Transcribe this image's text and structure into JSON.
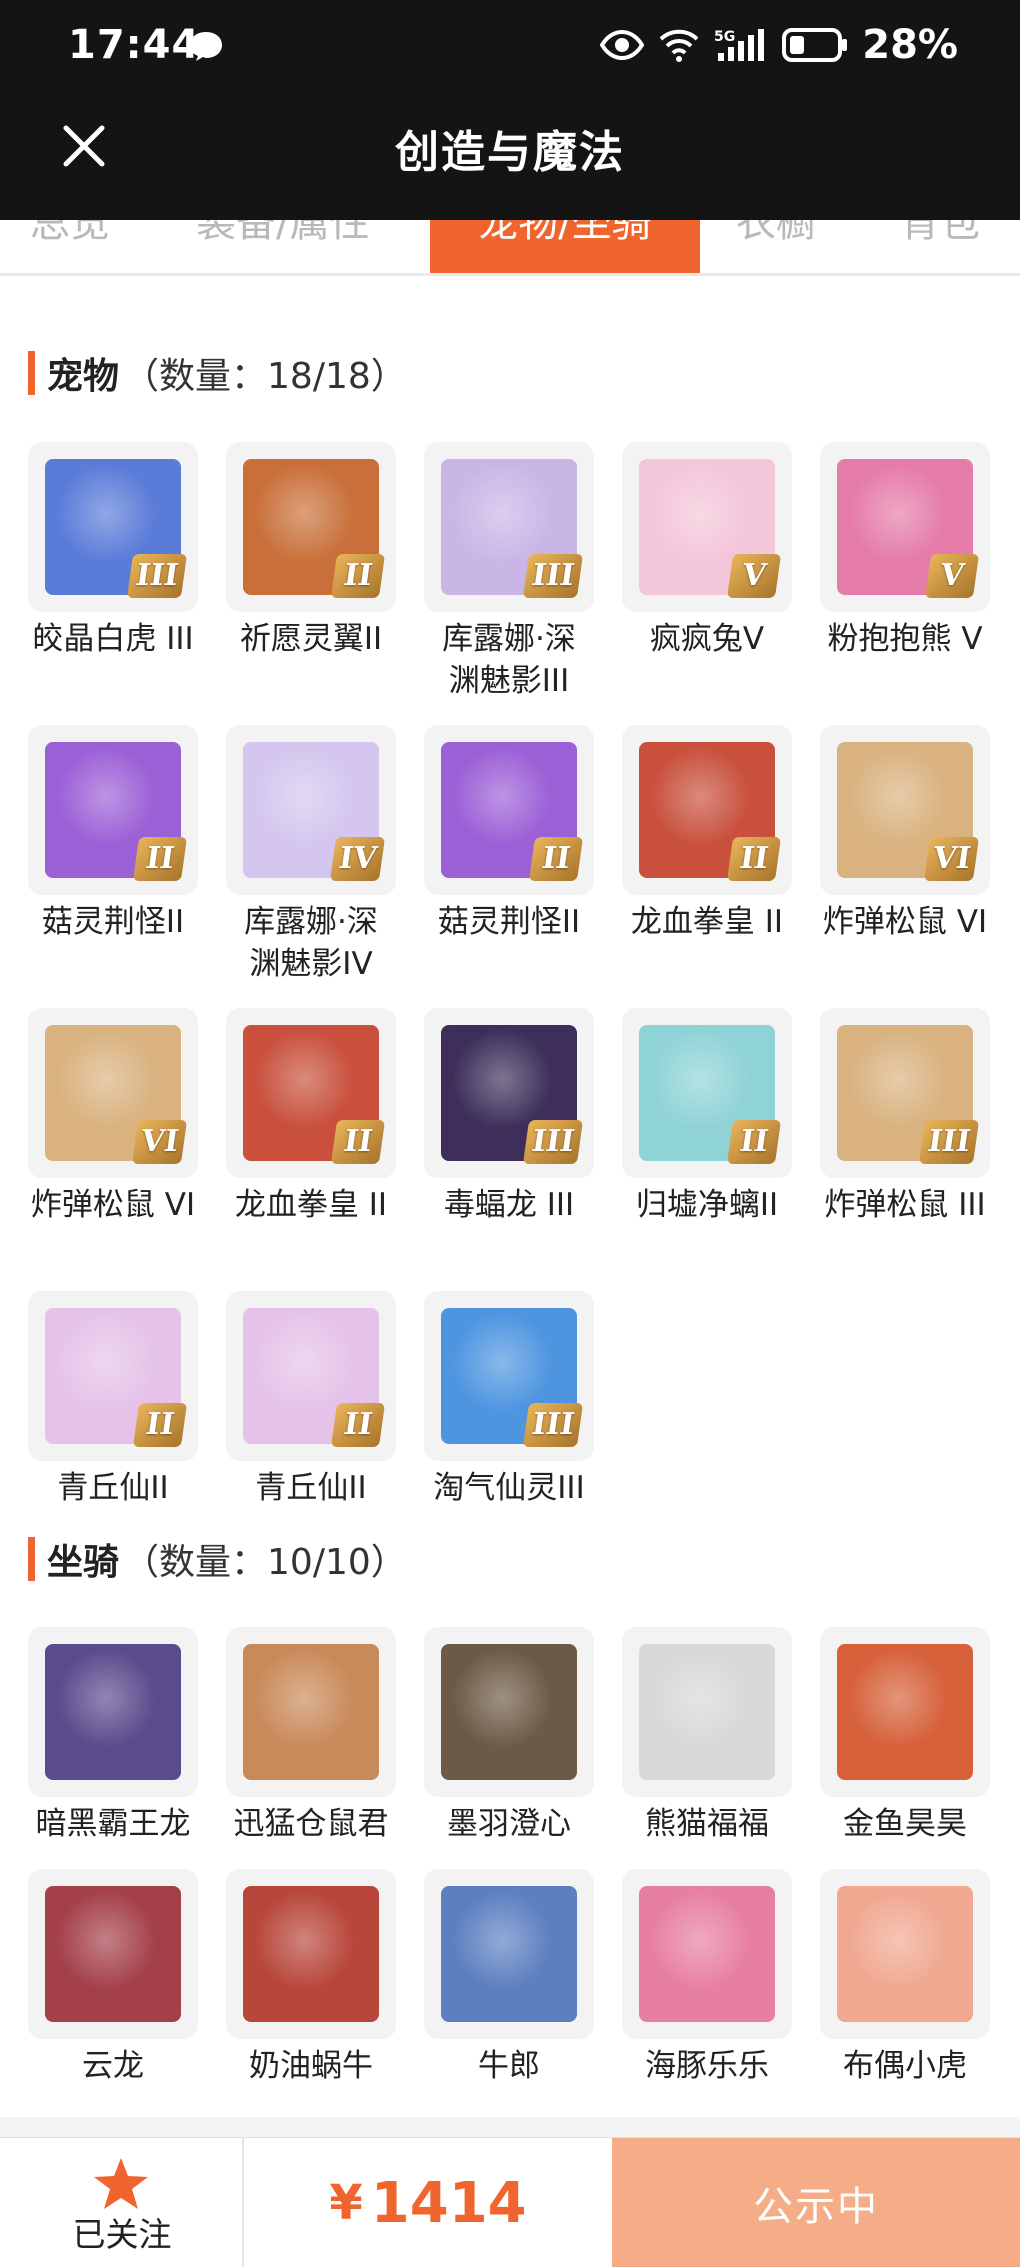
{
  "status_bar": {
    "time": "17:44",
    "battery": "28%",
    "network": "5G"
  },
  "header": {
    "title": "创造与魔法"
  },
  "tabs": [
    {
      "label": "总览"
    },
    {
      "label": "装备/属性"
    },
    {
      "label": "宠物/坐骑",
      "active": true
    },
    {
      "label": "衣橱"
    },
    {
      "label": "背包"
    }
  ],
  "pets": {
    "title": "宠物",
    "count": "（数量：18/18）",
    "items": [
      {
        "label": "皎晶白虎 III",
        "tier": "III",
        "color": "#5a7bd8"
      },
      {
        "label": "祈愿灵翼II",
        "tier": "II",
        "color": "#c9703a"
      },
      {
        "label": "库露娜·深\n渊魅影III",
        "tier": "III",
        "color": "#c9b6e6"
      },
      {
        "label": "疯疯兔V",
        "tier": "V",
        "color": "#f4c6d9"
      },
      {
        "label": "粉抱抱熊 V",
        "tier": "V",
        "color": "#e57ba8"
      },
      {
        "label": "菇灵荆怪II",
        "tier": "II",
        "color": "#9b5fd6"
      },
      {
        "label": "库露娜·深\n渊魅影IV",
        "tier": "IV",
        "color": "#d4c6ee"
      },
      {
        "label": "菇灵荆怪II",
        "tier": "II",
        "color": "#9b5fd6"
      },
      {
        "label": "龙血拳皇 II",
        "tier": "II",
        "color": "#c8503c"
      },
      {
        "label": "炸弹松鼠 VI",
        "tier": "VI",
        "color": "#d9b27f"
      },
      {
        "label": "炸弹松鼠 VI",
        "tier": "VI",
        "color": "#d9b27f"
      },
      {
        "label": "龙血拳皇 II",
        "tier": "II",
        "color": "#c8503c"
      },
      {
        "label": "毒蝠龙 III",
        "tier": "III",
        "color": "#3d2f5a"
      },
      {
        "label": "归墟净螭II",
        "tier": "II",
        "color": "#8fd3d6"
      },
      {
        "label": "炸弹松鼠 III",
        "tier": "III",
        "color": "#d9b27f"
      },
      {
        "label": "青丘仙II",
        "tier": "II",
        "color": "#e5c3e8"
      },
      {
        "label": "青丘仙II",
        "tier": "II",
        "color": "#e5c3e8"
      },
      {
        "label": "淘气仙灵III",
        "tier": "III",
        "color": "#4e95e0"
      }
    ]
  },
  "mounts": {
    "title": "坐骑",
    "count": "（数量：10/10）",
    "items": [
      {
        "label": "暗黑霸王龙",
        "color": "#5b4a8c"
      },
      {
        "label": "迅猛仓鼠君",
        "color": "#c98a5a"
      },
      {
        "label": "墨羽澄心",
        "color": "#6d5a46"
      },
      {
        "label": "熊猫福福",
        "color": "#d8d8d8"
      },
      {
        "label": "金鱼昊昊",
        "color": "#d6613a"
      },
      {
        "label": "云龙",
        "color": "#a4404a"
      },
      {
        "label": "奶油蜗牛",
        "color": "#b8463a"
      },
      {
        "label": "牛郎",
        "color": "#5c7fc0"
      },
      {
        "label": "海豚乐乐",
        "color": "#e77fa0"
      },
      {
        "label": "布偶小虎",
        "color": "#f0a890"
      }
    ]
  },
  "bottom_bar": {
    "follow_label": "已关注",
    "price_symbol": "¥",
    "price": "1414",
    "status_label": "公示中"
  },
  "colors": {
    "accent": "#f0642d",
    "status_button": "#f4ad86",
    "topbar": "#141414"
  }
}
